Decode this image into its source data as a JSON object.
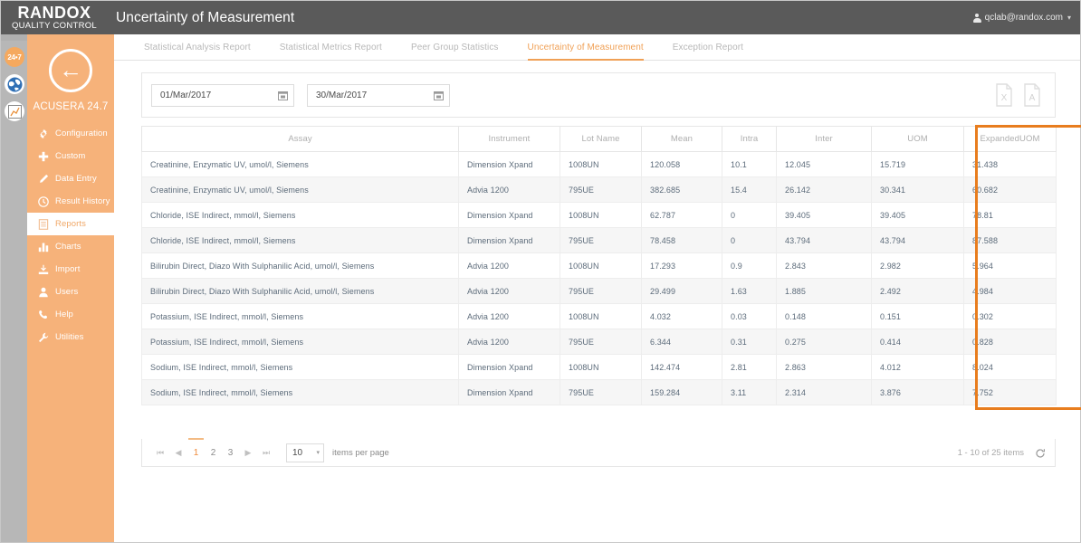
{
  "header": {
    "logo_main": "RANDOX",
    "logo_sub": "QUALITY CONTROL",
    "title": "Uncertainty of Measurement",
    "user_email": "qclab@randox.com",
    "user_caret": "▾",
    "user_icon": "user-icon"
  },
  "rail": {
    "items": [
      {
        "name": "24-7-badge-icon",
        "label": "24•7"
      },
      {
        "name": "globe-icon",
        "label": ""
      },
      {
        "name": "chart-icon",
        "label": ""
      }
    ]
  },
  "sidebar": {
    "back_arrow": "←",
    "brand": "ACUSERA 24.7",
    "items": [
      {
        "label": "Configuration",
        "icon": "gear-icon",
        "active": false
      },
      {
        "label": "Custom",
        "icon": "plus-icon",
        "active": false
      },
      {
        "label": "Data Entry",
        "icon": "pencil-icon",
        "active": false
      },
      {
        "label": "Result History",
        "icon": "clock-icon",
        "active": false
      },
      {
        "label": "Reports",
        "icon": "document-icon",
        "active": true
      },
      {
        "label": "Charts",
        "icon": "bar-chart-icon",
        "active": false
      },
      {
        "label": "Import",
        "icon": "import-icon",
        "active": false
      },
      {
        "label": "Users",
        "icon": "person-icon",
        "active": false
      },
      {
        "label": "Help",
        "icon": "phone-icon",
        "active": false
      },
      {
        "label": "Utilities",
        "icon": "wrench-icon",
        "active": false
      }
    ]
  },
  "tabs": [
    {
      "label": "Statistical Analysis Report",
      "active": false
    },
    {
      "label": "Statistical Metrics Report",
      "active": false
    },
    {
      "label": "Peer Group Statistics",
      "active": false
    },
    {
      "label": "Uncertainty of Measurement",
      "active": true
    },
    {
      "label": "Exception Report",
      "active": false
    }
  ],
  "filters": {
    "date_from": "01/Mar/2017",
    "date_to": "30/Mar/2017",
    "date_from_placeholder": "dd/MMM/yyyy",
    "date_to_placeholder": "dd/MMM/yyyy",
    "calendar_icon": "calendar-icon",
    "export_excel_icon": "excel-export-icon",
    "export_pdf_icon": "pdf-export-icon"
  },
  "table": {
    "columns": [
      "Assay",
      "Instrument",
      "Lot Name",
      "Mean",
      "Intra",
      "Inter",
      "UOM",
      "ExpandedUOM"
    ],
    "rows": [
      {
        "assay": "Creatinine, Enzymatic UV, umol/l, Siemens",
        "instrument": "Dimension Xpand",
        "lot": "1008UN",
        "mean": "120.058",
        "intra": "10.1",
        "inter": "12.045",
        "uom": "15.719",
        "expanded_uom": "31.438"
      },
      {
        "assay": "Creatinine, Enzymatic UV, umol/l, Siemens",
        "instrument": "Advia 1200",
        "lot": "795UE",
        "mean": "382.685",
        "intra": "15.4",
        "inter": "26.142",
        "uom": "30.341",
        "expanded_uom": "60.682"
      },
      {
        "assay": "Chloride, ISE Indirect, mmol/l, Siemens",
        "instrument": "Dimension Xpand",
        "lot": "1008UN",
        "mean": "62.787",
        "intra": "0",
        "inter": "39.405",
        "uom": "39.405",
        "expanded_uom": "78.81"
      },
      {
        "assay": "Chloride, ISE Indirect, mmol/l, Siemens",
        "instrument": "Dimension Xpand",
        "lot": "795UE",
        "mean": "78.458",
        "intra": "0",
        "inter": "43.794",
        "uom": "43.794",
        "expanded_uom": "87.588"
      },
      {
        "assay": "Bilirubin Direct, Diazo With Sulphanilic Acid, umol/l, Siemens",
        "instrument": "Advia 1200",
        "lot": "1008UN",
        "mean": "17.293",
        "intra": "0.9",
        "inter": "2.843",
        "uom": "2.982",
        "expanded_uom": "5.964"
      },
      {
        "assay": "Bilirubin Direct, Diazo With Sulphanilic Acid, umol/l, Siemens",
        "instrument": "Advia 1200",
        "lot": "795UE",
        "mean": "29.499",
        "intra": "1.63",
        "inter": "1.885",
        "uom": "2.492",
        "expanded_uom": "4.984"
      },
      {
        "assay": "Potassium, ISE Indirect, mmol/l, Siemens",
        "instrument": "Advia 1200",
        "lot": "1008UN",
        "mean": "4.032",
        "intra": "0.03",
        "inter": "0.148",
        "uom": "0.151",
        "expanded_uom": "0.302"
      },
      {
        "assay": "Potassium, ISE Indirect, mmol/l, Siemens",
        "instrument": "Advia 1200",
        "lot": "795UE",
        "mean": "6.344",
        "intra": "0.31",
        "inter": "0.275",
        "uom": "0.414",
        "expanded_uom": "0.828"
      },
      {
        "assay": "Sodium, ISE Indirect, mmol/l, Siemens",
        "instrument": "Dimension Xpand",
        "lot": "1008UN",
        "mean": "142.474",
        "intra": "2.81",
        "inter": "2.863",
        "uom": "4.012",
        "expanded_uom": "8.024"
      },
      {
        "assay": "Sodium, ISE Indirect, mmol/l, Siemens",
        "instrument": "Dimension Xpand",
        "lot": "795UE",
        "mean": "159.284",
        "intra": "3.11",
        "inter": "2.314",
        "uom": "3.876",
        "expanded_uom": "7.752"
      }
    ]
  },
  "pager": {
    "first": "⏮",
    "prev": "◀",
    "pages": [
      "1",
      "2",
      "3"
    ],
    "active_page": "1",
    "next": "▶",
    "last": "⏭",
    "page_size": "10",
    "page_size_caret": "▾",
    "items_per_page_label": "items per page",
    "range_text": "1 - 10 of 25 items",
    "refresh_icon": "refresh-icon"
  },
  "colors": {
    "brand_orange": "#f6b27a",
    "accent_orange": "#f0a055",
    "highlight_border": "#e87d1e",
    "topbar_gray": "#5a5a5a",
    "rail_gray": "#b7b7b7"
  }
}
